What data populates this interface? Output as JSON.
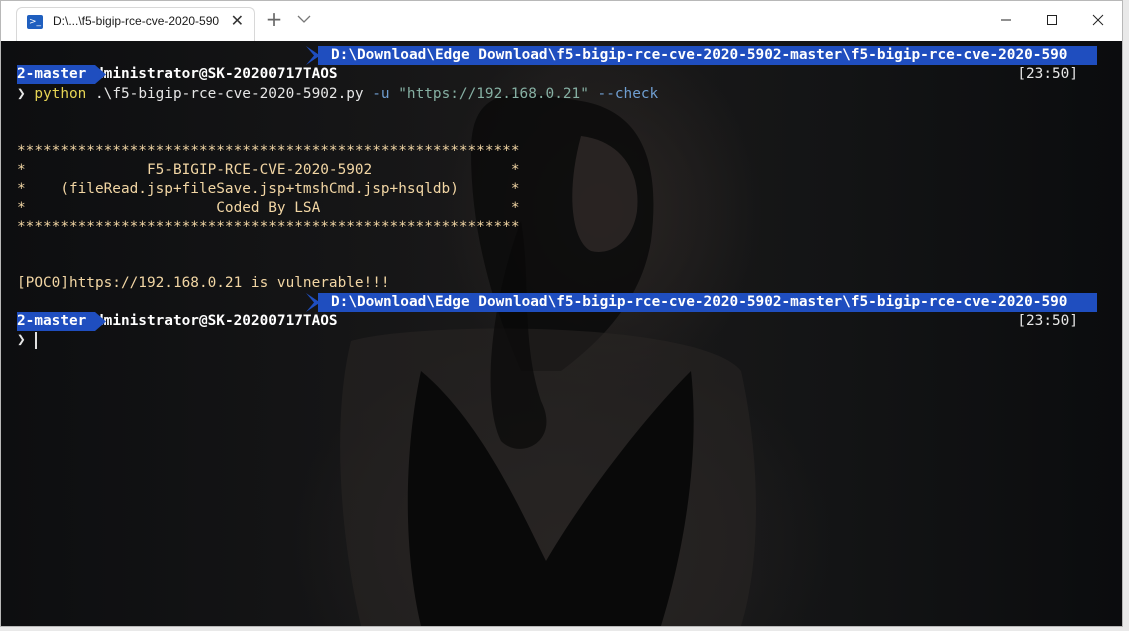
{
  "window": {
    "tab_title": "D:\\...\\f5-bigip-rce-cve-2020-590",
    "tab_icon": "powershell-icon",
    "close_tab_glyph": "✕",
    "new_tab_glyph": "+",
    "controls": [
      "minimize-icon",
      "maximize-icon",
      "close-icon"
    ]
  },
  "terminal": {
    "prompt1": {
      "bolt": "⚡",
      "user": "Administrator@SK-20200717TAOS",
      "path_line1": "D:\\Download\\Edge Download\\f5-bigip-rce-cve-2020-5902-master\\f5-bigip-rce-cve-2020-590",
      "path_line2": "2-master",
      "time": "[23:50]"
    },
    "command": {
      "caret": "❯",
      "exe": "python",
      "script": ".\\f5-bigip-rce-cve-2020-5902.py",
      "flag_u": "-u",
      "url": "\"https://192.168.0.21\"",
      "flag_check": "--check"
    },
    "banner": [
      "**********************************************************",
      "*              F5-BIGIP-RCE-CVE-2020-5902                *",
      "*    (fileRead.jsp+fileSave.jsp+tmshCmd.jsp+hsqldb)      *",
      "*                      Coded By LSA                      *",
      "**********************************************************"
    ],
    "result": "[POC0]https://192.168.0.21 is vulnerable!!!",
    "prompt2": {
      "bolt": "⚡",
      "user": "Administrator@SK-20200717TAOS",
      "path_line1": "D:\\Download\\Edge Download\\f5-bigip-rce-cve-2020-5902-master\\f5-bigip-rce-cve-2020-590",
      "path_line2": "2-master",
      "time": "[23:50]"
    },
    "caret2": "❯"
  }
}
